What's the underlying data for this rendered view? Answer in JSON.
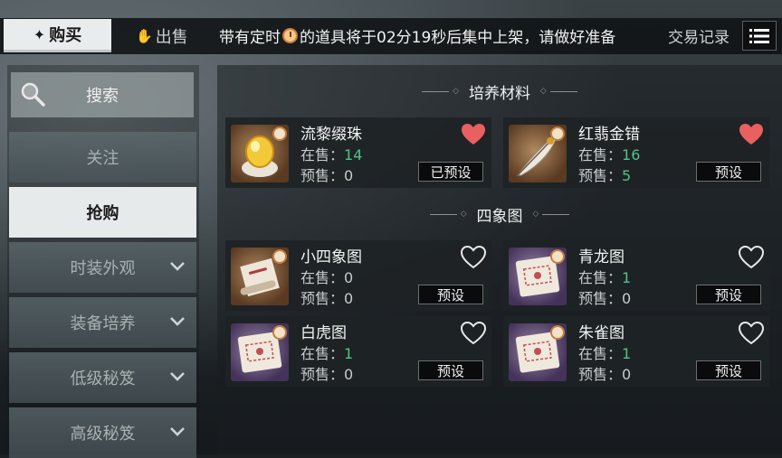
{
  "top": {
    "tab_buy": "购买",
    "tab_sell": "出售",
    "notice_part1": "带有定时",
    "notice_part2": "的道具将于02分19秒后集中上架，请做好准备",
    "trade_log": "交易记录",
    "menu_icon": "list-icon"
  },
  "sidebar": {
    "search_label": "搜索",
    "items": [
      {
        "label": "关注",
        "active": false,
        "chevron": false
      },
      {
        "label": "抢购",
        "active": true,
        "chevron": false
      },
      {
        "label": "时装外观",
        "active": false,
        "chevron": true
      },
      {
        "label": "装备培养",
        "active": false,
        "chevron": true
      },
      {
        "label": "低级秘笈",
        "active": false,
        "chevron": true
      },
      {
        "label": "高级秘笈",
        "active": false,
        "chevron": true
      }
    ]
  },
  "sections": [
    {
      "title": "培养材料",
      "items": [
        {
          "name": "流黎缀珠",
          "on_sale_label": "在售：",
          "on_sale": "14",
          "on_sale_green": true,
          "presale_label": "预售：",
          "presale": "0",
          "presale_green": false,
          "favorited": true,
          "button": "已预设",
          "icon": "golden-pearl-icon"
        },
        {
          "name": "红翡金错",
          "on_sale_label": "在售：",
          "on_sale": "16",
          "on_sale_green": true,
          "presale_label": "预售：",
          "presale": "5",
          "presale_green": true,
          "favorited": true,
          "button": "预设",
          "icon": "feather-icon"
        }
      ]
    },
    {
      "title": "四象图",
      "items": [
        {
          "name": "小四象图",
          "on_sale_label": "在售：",
          "on_sale": "0",
          "on_sale_green": false,
          "presale_label": "预售：",
          "presale": "0",
          "presale_green": false,
          "favorited": false,
          "button": "预设",
          "icon": "scroll-icon"
        },
        {
          "name": "青龙图",
          "on_sale_label": "在售：",
          "on_sale": "1",
          "on_sale_green": true,
          "presale_label": "预售：",
          "presale": "0",
          "presale_green": false,
          "favorited": false,
          "button": "预设",
          "icon": "map-scroll-icon"
        },
        {
          "name": "白虎图",
          "on_sale_label": "在售：",
          "on_sale": "1",
          "on_sale_green": true,
          "presale_label": "预售：",
          "presale": "0",
          "presale_green": false,
          "favorited": false,
          "button": "预设",
          "icon": "map-scroll-icon"
        },
        {
          "name": "朱雀图",
          "on_sale_label": "在售：",
          "on_sale": "1",
          "on_sale_green": true,
          "presale_label": "预售：",
          "presale": "0",
          "presale_green": false,
          "favorited": false,
          "button": "预设",
          "icon": "map-scroll-icon"
        }
      ]
    }
  ],
  "colors": {
    "accent_green": "#4fc38a",
    "heart_red": "#e86060"
  }
}
